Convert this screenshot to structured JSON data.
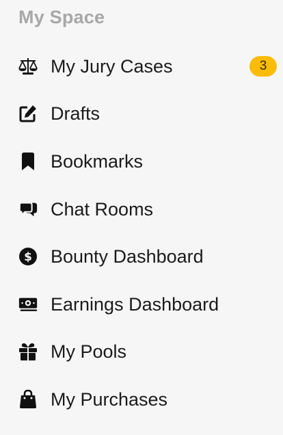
{
  "section": {
    "title": "My Space"
  },
  "menu": {
    "items": [
      {
        "label": "My Jury Cases",
        "icon": "scale-icon",
        "badge": "3"
      },
      {
        "label": "Drafts",
        "icon": "edit-icon"
      },
      {
        "label": "Bookmarks",
        "icon": "bookmark-icon"
      },
      {
        "label": "Chat Rooms",
        "icon": "chat-icon"
      },
      {
        "label": "Bounty Dashboard",
        "icon": "dollar-circle-icon"
      },
      {
        "label": "Earnings Dashboard",
        "icon": "money-bill-icon"
      },
      {
        "label": "My Pools",
        "icon": "gift-icon"
      },
      {
        "label": "My Purchases",
        "icon": "shopping-bag-icon"
      }
    ]
  },
  "colors": {
    "background": "#f6f6f6",
    "text": "#1b1b1b",
    "section_title": "#a7a7a7",
    "badge": "#fbbc05"
  }
}
